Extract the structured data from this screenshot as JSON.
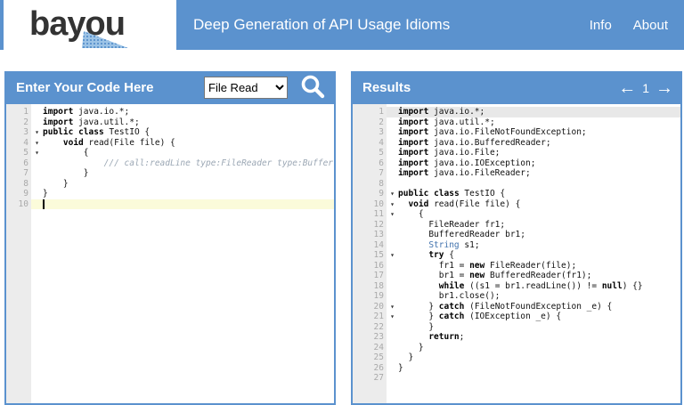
{
  "navbar": {
    "logo_text": "bayou",
    "title": "Deep Generation of API Usage Idioms",
    "links": [
      {
        "label": "Info"
      },
      {
        "label": "About"
      }
    ]
  },
  "icons": {
    "search": "magnifier-icon",
    "fold_arrow": "▾",
    "prev_arrow": "←",
    "next_arrow": "→"
  },
  "colors": {
    "accent_blue": "#5b92ce",
    "active_line_yellow": "#fbfbda",
    "result_highlight_gray": "#e8e8e8",
    "keyword": "#000000",
    "type_blue": "#4273ae",
    "comment_gray_blue": "#9ba7b4",
    "gutter_gray": "#ececec"
  },
  "left_panel": {
    "title": "Enter Your Code Here",
    "selector_value": "File Read",
    "editor": {
      "lines": [
        {
          "n": 1,
          "seg": [
            {
              "s": "k",
              "t": "import"
            },
            {
              "s": "p",
              "t": " java.io.*;"
            }
          ]
        },
        {
          "n": 2,
          "seg": [
            {
              "s": "k",
              "t": "import"
            },
            {
              "s": "p",
              "t": " java.util.*;"
            }
          ]
        },
        {
          "n": 3,
          "fold": true,
          "seg": [
            {
              "s": "k",
              "t": "public"
            },
            {
              "s": "p",
              "t": " "
            },
            {
              "s": "k",
              "t": "class"
            },
            {
              "s": "p",
              "t": " TestIO {"
            }
          ]
        },
        {
          "n": 4,
          "fold": true,
          "seg": [
            {
              "s": "p",
              "t": "    "
            },
            {
              "s": "k",
              "t": "void"
            },
            {
              "s": "p",
              "t": " read(File file) {"
            }
          ]
        },
        {
          "n": 5,
          "fold": true,
          "seg": [
            {
              "s": "p",
              "t": "        {"
            }
          ]
        },
        {
          "n": 6,
          "seg": [
            {
              "s": "p",
              "t": "            "
            },
            {
              "s": "c",
              "t": "/// call:readLine type:FileReader type:Buffer"
            }
          ]
        },
        {
          "n": 7,
          "seg": [
            {
              "s": "p",
              "t": "        }"
            }
          ]
        },
        {
          "n": 8,
          "seg": [
            {
              "s": "p",
              "t": "    }"
            }
          ]
        },
        {
          "n": 9,
          "seg": [
            {
              "s": "p",
              "t": "}"
            }
          ]
        },
        {
          "n": 10,
          "active": true,
          "cursor": true,
          "seg": []
        }
      ]
    }
  },
  "right_panel": {
    "title": "Results",
    "pager": {
      "prev": "←",
      "page": "1",
      "next": "→"
    },
    "editor": {
      "lines": [
        {
          "n": 1,
          "hl": true,
          "seg": [
            {
              "s": "k",
              "t": "import"
            },
            {
              "s": "p",
              "t": " java.io.*;"
            }
          ]
        },
        {
          "n": 2,
          "seg": [
            {
              "s": "k",
              "t": "import"
            },
            {
              "s": "p",
              "t": " java.util.*;"
            }
          ]
        },
        {
          "n": 3,
          "seg": [
            {
              "s": "k",
              "t": "import"
            },
            {
              "s": "p",
              "t": " java.io.FileNotFoundException;"
            }
          ]
        },
        {
          "n": 4,
          "seg": [
            {
              "s": "k",
              "t": "import"
            },
            {
              "s": "p",
              "t": " java.io.BufferedReader;"
            }
          ]
        },
        {
          "n": 5,
          "seg": [
            {
              "s": "k",
              "t": "import"
            },
            {
              "s": "p",
              "t": " java.io.File;"
            }
          ]
        },
        {
          "n": 6,
          "seg": [
            {
              "s": "k",
              "t": "import"
            },
            {
              "s": "p",
              "t": " java.io.IOException;"
            }
          ]
        },
        {
          "n": 7,
          "seg": [
            {
              "s": "k",
              "t": "import"
            },
            {
              "s": "p",
              "t": " java.io.FileReader;"
            }
          ]
        },
        {
          "n": 8,
          "seg": []
        },
        {
          "n": 9,
          "fold": true,
          "seg": [
            {
              "s": "k",
              "t": "public"
            },
            {
              "s": "p",
              "t": " "
            },
            {
              "s": "k",
              "t": "class"
            },
            {
              "s": "p",
              "t": " TestIO {"
            }
          ]
        },
        {
          "n": 10,
          "fold": true,
          "seg": [
            {
              "s": "p",
              "t": "  "
            },
            {
              "s": "k",
              "t": "void"
            },
            {
              "s": "p",
              "t": " read(File file) {"
            }
          ]
        },
        {
          "n": 11,
          "fold": true,
          "seg": [
            {
              "s": "p",
              "t": "    {"
            }
          ]
        },
        {
          "n": 12,
          "seg": [
            {
              "s": "p",
              "t": "      FileReader fr1;"
            }
          ]
        },
        {
          "n": 13,
          "seg": [
            {
              "s": "p",
              "t": "      BufferedReader br1;"
            }
          ]
        },
        {
          "n": 14,
          "seg": [
            {
              "s": "p",
              "t": "      "
            },
            {
              "s": "t",
              "t": "String"
            },
            {
              "s": "p",
              "t": " s1;"
            }
          ]
        },
        {
          "n": 15,
          "fold": true,
          "seg": [
            {
              "s": "p",
              "t": "      "
            },
            {
              "s": "k",
              "t": "try"
            },
            {
              "s": "p",
              "t": " {"
            }
          ]
        },
        {
          "n": 16,
          "seg": [
            {
              "s": "p",
              "t": "        fr1 = "
            },
            {
              "s": "k",
              "t": "new"
            },
            {
              "s": "p",
              "t": " FileReader(file);"
            }
          ]
        },
        {
          "n": 17,
          "seg": [
            {
              "s": "p",
              "t": "        br1 = "
            },
            {
              "s": "k",
              "t": "new"
            },
            {
              "s": "p",
              "t": " BufferedReader(fr1);"
            }
          ]
        },
        {
          "n": 18,
          "seg": [
            {
              "s": "p",
              "t": "        "
            },
            {
              "s": "k",
              "t": "while"
            },
            {
              "s": "p",
              "t": " ((s1 = br1.readLine()) != "
            },
            {
              "s": "k",
              "t": "null"
            },
            {
              "s": "p",
              "t": ") {}"
            }
          ]
        },
        {
          "n": 19,
          "seg": [
            {
              "s": "p",
              "t": "        br1.close();"
            }
          ]
        },
        {
          "n": 20,
          "fold": true,
          "seg": [
            {
              "s": "p",
              "t": "      } "
            },
            {
              "s": "k",
              "t": "catch"
            },
            {
              "s": "p",
              "t": " (FileNotFoundException _e) {"
            }
          ]
        },
        {
          "n": 21,
          "fold": true,
          "seg": [
            {
              "s": "p",
              "t": "      } "
            },
            {
              "s": "k",
              "t": "catch"
            },
            {
              "s": "p",
              "t": " (IOException _e) {"
            }
          ]
        },
        {
          "n": 22,
          "seg": [
            {
              "s": "p",
              "t": "      }"
            }
          ]
        },
        {
          "n": 23,
          "seg": [
            {
              "s": "p",
              "t": "      "
            },
            {
              "s": "k",
              "t": "return"
            },
            {
              "s": "p",
              "t": ";"
            }
          ]
        },
        {
          "n": 24,
          "seg": [
            {
              "s": "p",
              "t": "    }"
            }
          ]
        },
        {
          "n": 25,
          "seg": [
            {
              "s": "p",
              "t": "  }"
            }
          ]
        },
        {
          "n": 26,
          "seg": [
            {
              "s": "p",
              "t": "}"
            }
          ]
        },
        {
          "n": 27,
          "seg": []
        }
      ]
    }
  }
}
